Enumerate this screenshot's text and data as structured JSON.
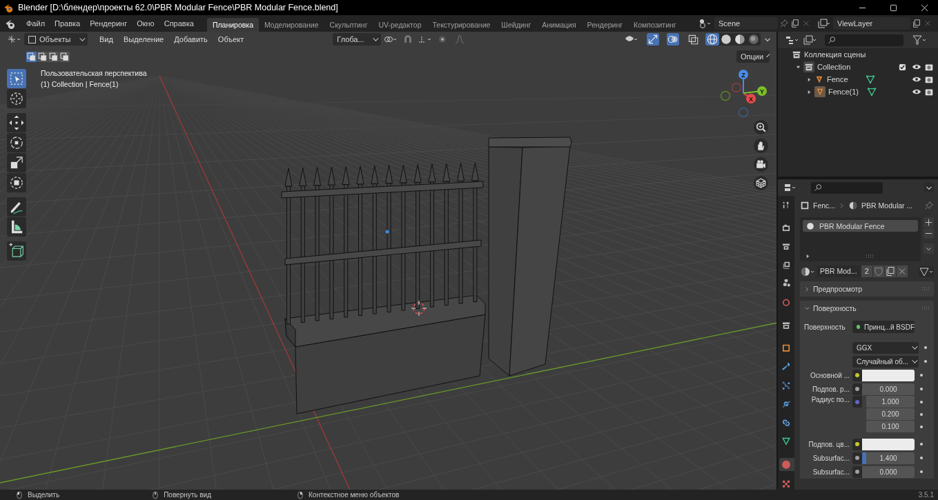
{
  "window": {
    "title": "Blender [D:\\блендер\\проекты 62.0\\PBR Modular Fence\\PBR Modular Fence.blend]"
  },
  "menu": [
    "Файл",
    "Правка",
    "Рендеринг",
    "Окно",
    "Справка"
  ],
  "workspaces": [
    {
      "label": "Планировка",
      "selected": true
    },
    {
      "label": "Моделирование",
      "selected": false
    },
    {
      "label": "Скульптинг",
      "selected": false
    },
    {
      "label": "UV-редактор",
      "selected": false
    },
    {
      "label": "Текстурирование",
      "selected": false
    },
    {
      "label": "Шейдинг",
      "selected": false
    },
    {
      "label": "Анимация",
      "selected": false
    },
    {
      "label": "Рендеринг",
      "selected": false
    },
    {
      "label": "Композитинг",
      "selected": false
    }
  ],
  "scene": {
    "name": "Scene"
  },
  "view_layer": {
    "name": "ViewLayer"
  },
  "viewport": {
    "mode": "Объекты",
    "menus": [
      "Вид",
      "Выделение",
      "Добавить",
      "Объект"
    ],
    "orientation": "Глоба...",
    "select_modes": [
      {
        "selected": true
      },
      {
        "selected": false
      },
      {
        "selected": false
      },
      {
        "selected": false
      }
    ],
    "toggles": [
      {
        "kind": "gizmo",
        "on": true
      },
      {
        "kind": "overlay",
        "on": true
      },
      {
        "kind": "xray",
        "on": false
      }
    ],
    "shading": [
      {
        "kind": "wireframe",
        "selected": true
      },
      {
        "kind": "solid",
        "selected": false
      },
      {
        "kind": "material",
        "selected": false
      },
      {
        "kind": "rendered",
        "selected": false
      }
    ],
    "options": "Опции",
    "view_name": "Пользовательская перспектива",
    "context": "(1) Collection | Fence(1)",
    "tools": [
      {
        "kind": "select",
        "selected": true
      },
      {
        "kind": "cursor",
        "selected": false
      },
      {
        "kind": "move",
        "selected": false
      },
      {
        "kind": "rotate",
        "selected": false
      },
      {
        "kind": "scale",
        "selected": false
      },
      {
        "kind": "transform",
        "selected": false
      },
      {
        "kind": "annotate",
        "selected": false
      },
      {
        "kind": "measure",
        "selected": false
      },
      {
        "kind": "add_cube",
        "selected": false
      }
    ],
    "gizmo_axes": [
      "X",
      "Y",
      "Z"
    ]
  },
  "outliner": {
    "root": "Коллекция сцены",
    "collections": [
      {
        "label": "Collection",
        "expanded": true,
        "checked": true,
        "children": [
          {
            "label": "Fence",
            "expanded": false,
            "active": false
          },
          {
            "label": "Fence(1)",
            "expanded": false,
            "active": true
          }
        ]
      }
    ]
  },
  "properties": {
    "breadcrumb": [
      "Fenc...",
      "PBR Modular ..."
    ],
    "tabs": [
      {
        "kind": "tool",
        "selected": false
      },
      {
        "kind": "render",
        "selected": false
      },
      {
        "kind": "output",
        "selected": false
      },
      {
        "kind": "view_layer",
        "selected": false
      },
      {
        "kind": "scene",
        "selected": false
      },
      {
        "kind": "world",
        "selected": false
      },
      {
        "kind": "collection",
        "selected": false
      },
      {
        "kind": "object",
        "selected": false
      },
      {
        "kind": "modifiers",
        "selected": false
      },
      {
        "kind": "particles",
        "selected": false
      },
      {
        "kind": "physics",
        "selected": false
      },
      {
        "kind": "constraints",
        "selected": false
      },
      {
        "kind": "data",
        "selected": false
      },
      {
        "kind": "material",
        "selected": true
      },
      {
        "kind": "texture",
        "selected": false
      }
    ],
    "slots": [
      {
        "label": "PBR Modular Fence",
        "selected": true
      }
    ],
    "material": {
      "name": "PBR Mod...",
      "users": "2"
    },
    "panels": [
      {
        "label": "Предпросмотр",
        "expanded": false
      },
      {
        "label": "Поверхность",
        "expanded": true
      }
    ],
    "fields": [
      {
        "kind": "link",
        "label": "Поверхность",
        "value": "Принц...й BSDF",
        "color": "#63c763"
      },
      {
        "kind": "dropdown",
        "value": "GGX"
      },
      {
        "kind": "dropdown",
        "value": "Случайный об..."
      },
      {
        "kind": "swatch",
        "label": "Основной ...",
        "color": "#c7c729"
      },
      {
        "kind": "number",
        "label": "Подпов. р...",
        "value": "0.000",
        "color": "#a1a1a1"
      },
      {
        "kind": "vector",
        "label": "Радиус по...",
        "values": [
          "1.000",
          "0.200",
          "0.100"
        ],
        "color": "#6363c7"
      },
      {
        "kind": "swatch",
        "label": "Подпов. цв...",
        "color": "#c7c729"
      },
      {
        "kind": "number",
        "label": "Subsurfac...",
        "value": "1.400",
        "level": 0.08,
        "color": "#a1a1a1"
      },
      {
        "kind": "number",
        "label": "Subsurfac...",
        "value": "0.000",
        "color": "#a1a1a1"
      }
    ]
  },
  "status_bar": {
    "hints": [
      "Выделить",
      "Повернуть вид",
      "Контекстное меню объектов"
    ],
    "version": "3.5.1"
  }
}
